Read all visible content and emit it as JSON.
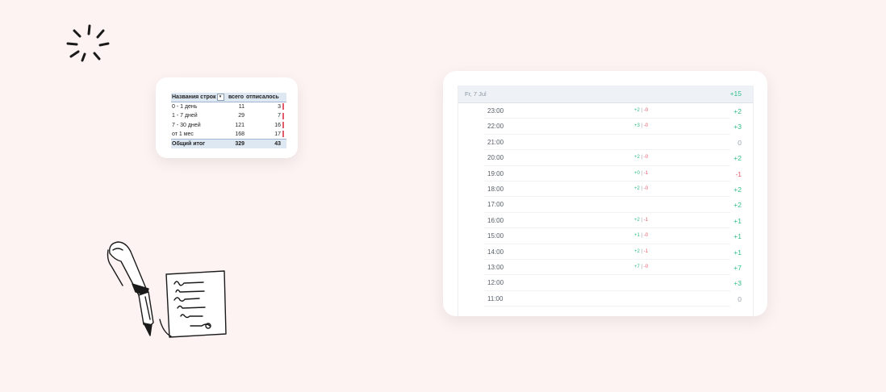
{
  "pivot_table": {
    "headers": [
      "Названия строк",
      "всего",
      "отписалось",
      ""
    ],
    "rows": [
      {
        "label": "0 - 1 день",
        "total": "11",
        "unsubscribed": "3"
      },
      {
        "label": "1 - 7 дней",
        "total": "29",
        "unsubscribed": "7"
      },
      {
        "label": "7 - 30 дней",
        "total": "121",
        "unsubscribed": "16"
      },
      {
        "label": "от 1 мес",
        "total": "168",
        "unsubscribed": "17"
      }
    ],
    "grand_total": {
      "label": "Общий итог",
      "total": "329",
      "unsubscribed": "43"
    },
    "accent_color": "#e35c6b",
    "header_bg": "#dde8f3"
  },
  "hourly_stats": {
    "date": "Fr, 7 Jul",
    "day_total": "+15",
    "rows": [
      {
        "time": "23:00",
        "added": "+2",
        "sep": " | ",
        "removed": "-0",
        "net": "+2",
        "trend": "pos"
      },
      {
        "time": "22:00",
        "added": "+3",
        "sep": " | ",
        "removed": "-0",
        "net": "+3",
        "trend": "pos"
      },
      {
        "time": "21:00",
        "added": "",
        "sep": "",
        "removed": "",
        "net": "0",
        "trend": "zero"
      },
      {
        "time": "20:00",
        "added": "+2",
        "sep": " | ",
        "removed": "-0",
        "net": "+2",
        "trend": "pos"
      },
      {
        "time": "19:00",
        "added": "+0",
        "sep": " | ",
        "removed": "-1",
        "net": "-1",
        "trend": "neg"
      },
      {
        "time": "18:00",
        "added": "+2",
        "sep": " | ",
        "removed": "-0",
        "net": "+2",
        "trend": "pos"
      },
      {
        "time": "17:00",
        "added": "",
        "sep": "",
        "removed": "",
        "net": "+2",
        "trend": "pos"
      },
      {
        "time": "16:00",
        "added": "+2",
        "sep": " | ",
        "removed": "-1",
        "net": "+1",
        "trend": "pos"
      },
      {
        "time": "15:00",
        "added": "+1",
        "sep": " | ",
        "removed": "-0",
        "net": "+1",
        "trend": "pos"
      },
      {
        "time": "14:00",
        "added": "+2",
        "sep": " | ",
        "removed": "-1",
        "net": "+1",
        "trend": "pos"
      },
      {
        "time": "13:00",
        "added": "+7",
        "sep": " | ",
        "removed": "-0",
        "net": "+7",
        "trend": "pos"
      },
      {
        "time": "12:00",
        "added": "",
        "sep": "",
        "removed": "",
        "net": "+3",
        "trend": "pos"
      },
      {
        "time": "11:00",
        "added": "",
        "sep": "",
        "removed": "",
        "net": "0",
        "trend": "zero"
      }
    ],
    "positive_color": "#2ebd85",
    "negative_color": "#e35c6b"
  },
  "decorations": {
    "sparkle_icon": "sparkle-icon",
    "pen_icon": "fountain-pen-icon",
    "paper_icon": "handwritten-letter-icon"
  }
}
